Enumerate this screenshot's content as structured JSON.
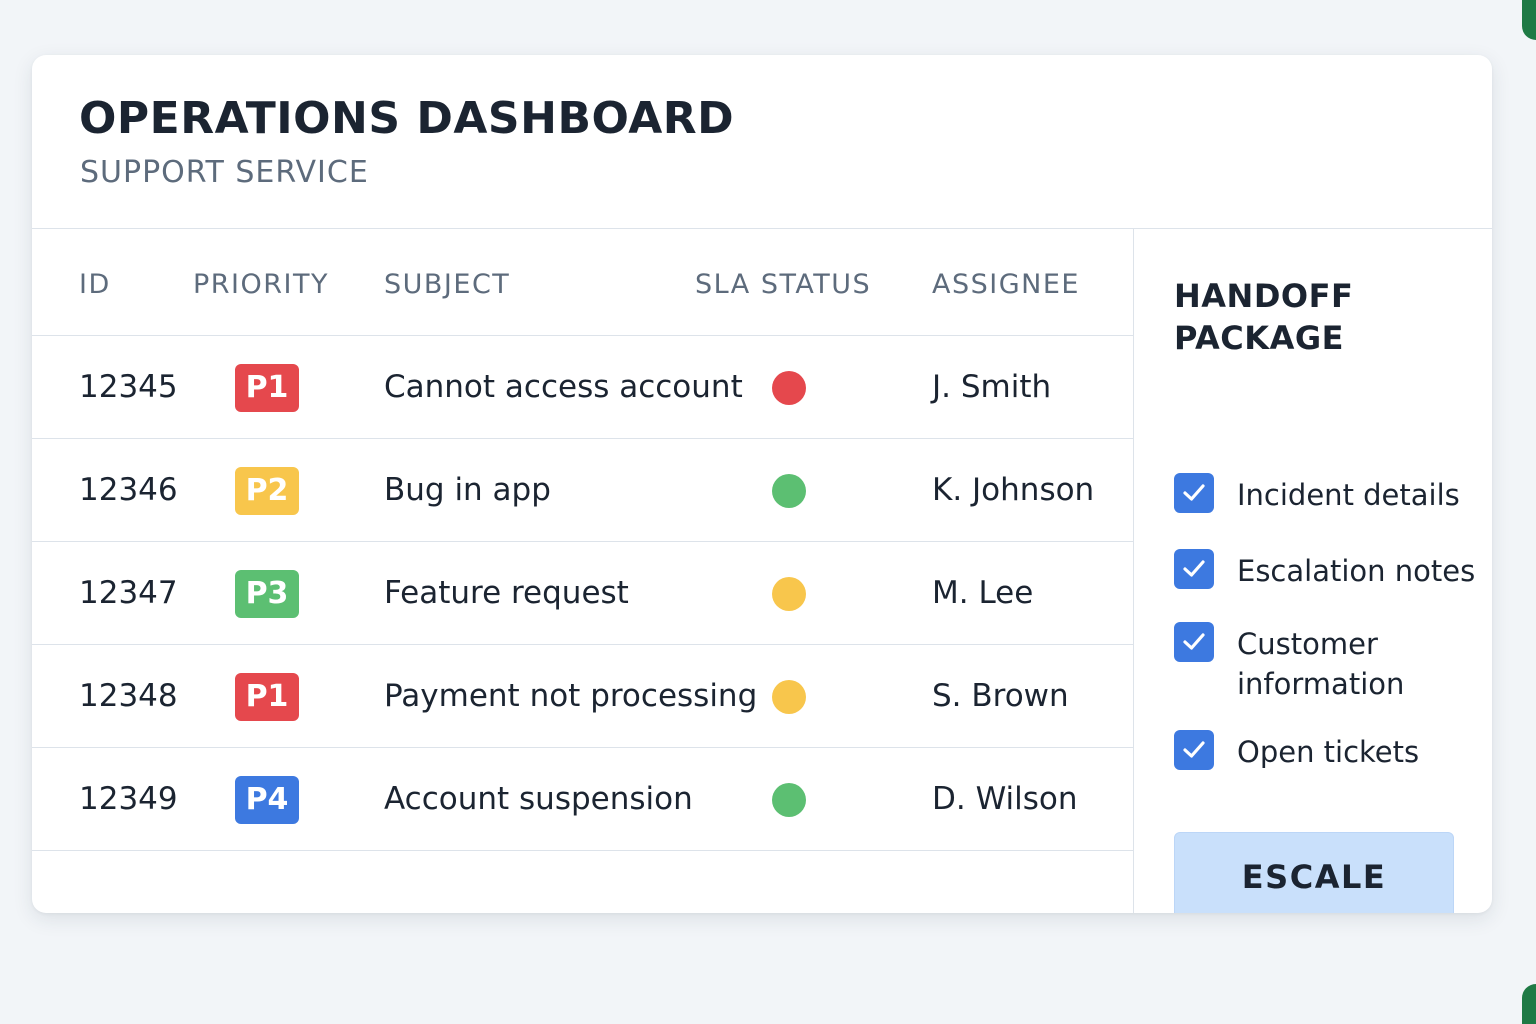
{
  "header": {
    "title": "OPERATIONS DASHBOARD",
    "subtitle": "SUPPORT SERVICE"
  },
  "table": {
    "columns": [
      "ID",
      "PRIORITY",
      "SUBJECT",
      "SLA STATUS",
      "ASSIGNEE"
    ],
    "rows": [
      {
        "id": "12345",
        "priority": "P1",
        "subject": "Cannot access account",
        "sla_status": "red",
        "assignee": "J. Smith"
      },
      {
        "id": "12346",
        "priority": "P2",
        "subject": "Bug in app",
        "sla_status": "green",
        "assignee": "K. Johnson"
      },
      {
        "id": "12347",
        "priority": "P3",
        "subject": "Feature request",
        "sla_status": "yellow",
        "assignee": "M. Lee"
      },
      {
        "id": "12348",
        "priority": "P1",
        "subject": "Payment not processing",
        "sla_status": "yellow",
        "assignee": "S. Brown"
      },
      {
        "id": "12349",
        "priority": "P4",
        "subject": "Account suspension",
        "sla_status": "green",
        "assignee": "D. Wilson"
      }
    ]
  },
  "colors": {
    "priority": {
      "P1": "#e5484d",
      "P2": "#f8c64c",
      "P3": "#5cbf72",
      "P4": "#3d79e0"
    },
    "sla": {
      "red": "#e5484d",
      "green": "#5cbf72",
      "yellow": "#f8c64c"
    },
    "accent": "#3d79e0"
  },
  "handoff": {
    "title": "HANDOFF PACKAGE",
    "items": [
      {
        "label": "Incident details",
        "checked": true
      },
      {
        "label": "Escalation notes",
        "checked": true
      },
      {
        "label": "Customer information",
        "checked": true
      },
      {
        "label": "Open tickets",
        "checked": true
      }
    ],
    "button_label": "ESCALE"
  }
}
